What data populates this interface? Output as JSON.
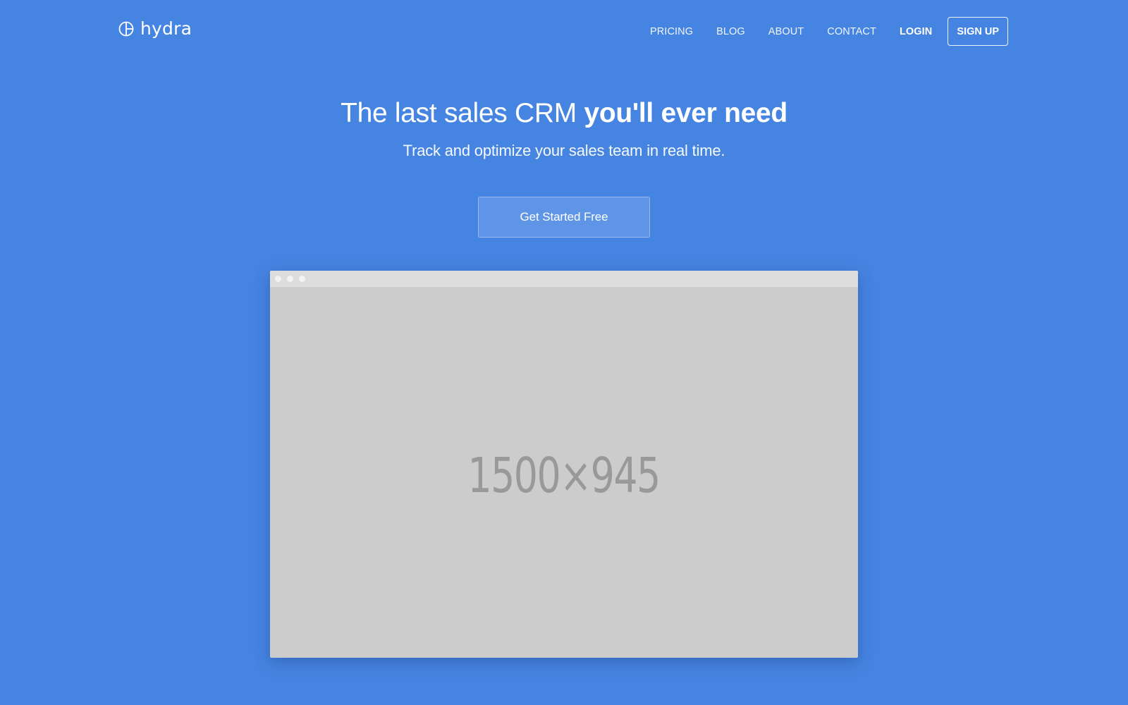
{
  "brand": {
    "name": "hydra",
    "icon": "hydra-logo-icon"
  },
  "nav": {
    "pricing": "PRICING",
    "blog": "BLOG",
    "about": "ABOUT",
    "contact": "CONTACT",
    "login": "LOGIN",
    "signup": "SIGN UP"
  },
  "hero": {
    "title_light": "The last sales CRM ",
    "title_bold": "you'll ever need",
    "subtitle": "Track and optimize your sales team in real time.",
    "cta": "Get Started Free"
  },
  "mockup": {
    "placeholder": "1500×945"
  },
  "colors": {
    "background": "#4684e1",
    "cta_background": "#5f95e6",
    "mockup_screen": "#cccccc",
    "mockup_bar": "#dddddd",
    "placeholder_text": "#999999"
  }
}
